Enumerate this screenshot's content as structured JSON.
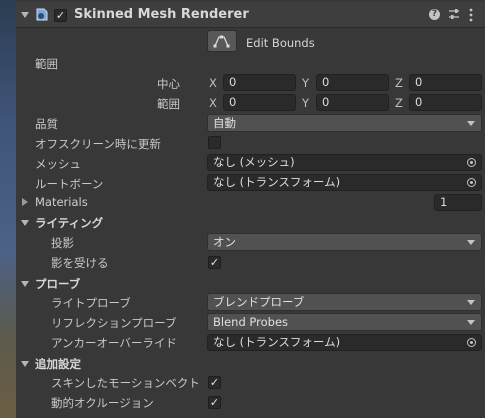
{
  "component": {
    "name": "Skinned Mesh Renderer"
  },
  "edit_bounds": {
    "label": "Edit Bounds"
  },
  "bounds": {
    "label": "範囲",
    "center": {
      "label": "中心",
      "x": "0",
      "y": "0",
      "z": "0"
    },
    "extent": {
      "label": "範囲",
      "x": "0",
      "y": "0",
      "z": "0"
    },
    "axis": {
      "x": "X",
      "y": "Y",
      "z": "Z"
    }
  },
  "quality": {
    "label": "品質",
    "value": "自動"
  },
  "offscreen": {
    "label": "オフスクリーン時に更新"
  },
  "mesh": {
    "label": "メッシュ",
    "value": "なし (メッシュ)"
  },
  "rootbone": {
    "label": "ルートボーン",
    "value": "なし (トランスフォーム)"
  },
  "materials": {
    "label": "Materials",
    "count": "1"
  },
  "lighting": {
    "label": "ライティング",
    "cast": {
      "label": "投影",
      "value": "オン"
    },
    "receive": {
      "label": "影を受ける"
    }
  },
  "probes": {
    "label": "プローブ",
    "light": {
      "label": "ライトプローブ",
      "value": "ブレンドプローブ"
    },
    "reflection": {
      "label": "リフレクションプローブ",
      "value": "Blend Probes"
    },
    "anchor": {
      "label": "アンカーオーバーライド",
      "value": "なし (トランスフォーム)"
    }
  },
  "additional": {
    "label": "追加設定",
    "skinned_motion": {
      "label": "スキンしたモーションベクト"
    },
    "dynamic_occlusion": {
      "label": "動的オクルージョン"
    }
  },
  "check_glyph": "✓",
  "icons": [
    "foldout-arrow-icon",
    "skinned-mesh-icon",
    "help-icon",
    "presets-icon",
    "more-menu-icon",
    "edit-bounds-icon",
    "object-picker-icon",
    "dropdown-arrow-icon"
  ]
}
